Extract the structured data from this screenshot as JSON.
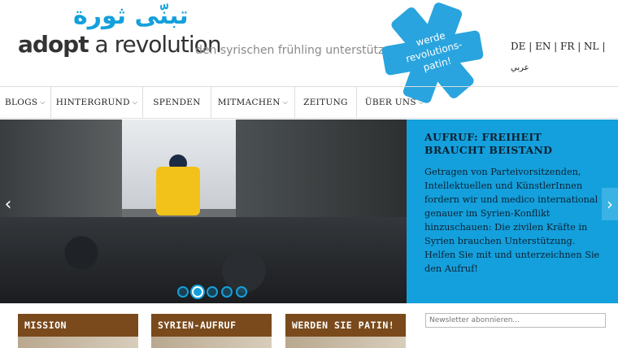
{
  "header": {
    "logo_arabic": "تبنّى ثورة",
    "logo_word1": "adopt",
    "logo_word2": "a revolution",
    "tagline": "den syrischen frühling unterstützen",
    "badge_text": [
      "werde",
      "revolutions-",
      "patin!"
    ],
    "languages": [
      "DE",
      "EN",
      "FR",
      "NL"
    ],
    "lang_arabic": "عربي"
  },
  "nav": [
    {
      "label": "BLOGS",
      "dropdown": true
    },
    {
      "label": "HINTERGRUND",
      "dropdown": true
    },
    {
      "label": "SPENDEN",
      "dropdown": false
    },
    {
      "label": "MITMACHEN",
      "dropdown": true
    },
    {
      "label": "ZEITUNG",
      "dropdown": false
    },
    {
      "label": "ÜBER UNS",
      "dropdown": true
    }
  ],
  "callout": {
    "title": "AUFRUF: FREIHEIT BRAUCHT BEISTAND",
    "body": "Getragen von Parteivorsitzenden, Intellektuellen und KünstlerInnen fordern wir und medico international genauer im Syrien-Konflikt hinzuschauen: Die zivilen Kräfte in Syrien brauchen Unterstützung. Helfen Sie mit und unterzeichnen Sie den Aufruf!"
  },
  "slider": {
    "slides": 5,
    "active": 2
  },
  "boxes": [
    {
      "title": "MISSION"
    },
    {
      "title": "SYRIEN-AUFRUF"
    },
    {
      "title": "WERDEN SIE PATIN!"
    }
  ],
  "newsletter": {
    "placeholder": "Newsletter abonnieren..."
  },
  "colors": {
    "accent": "#14a0dc",
    "box_header": "#7a4a1c"
  }
}
